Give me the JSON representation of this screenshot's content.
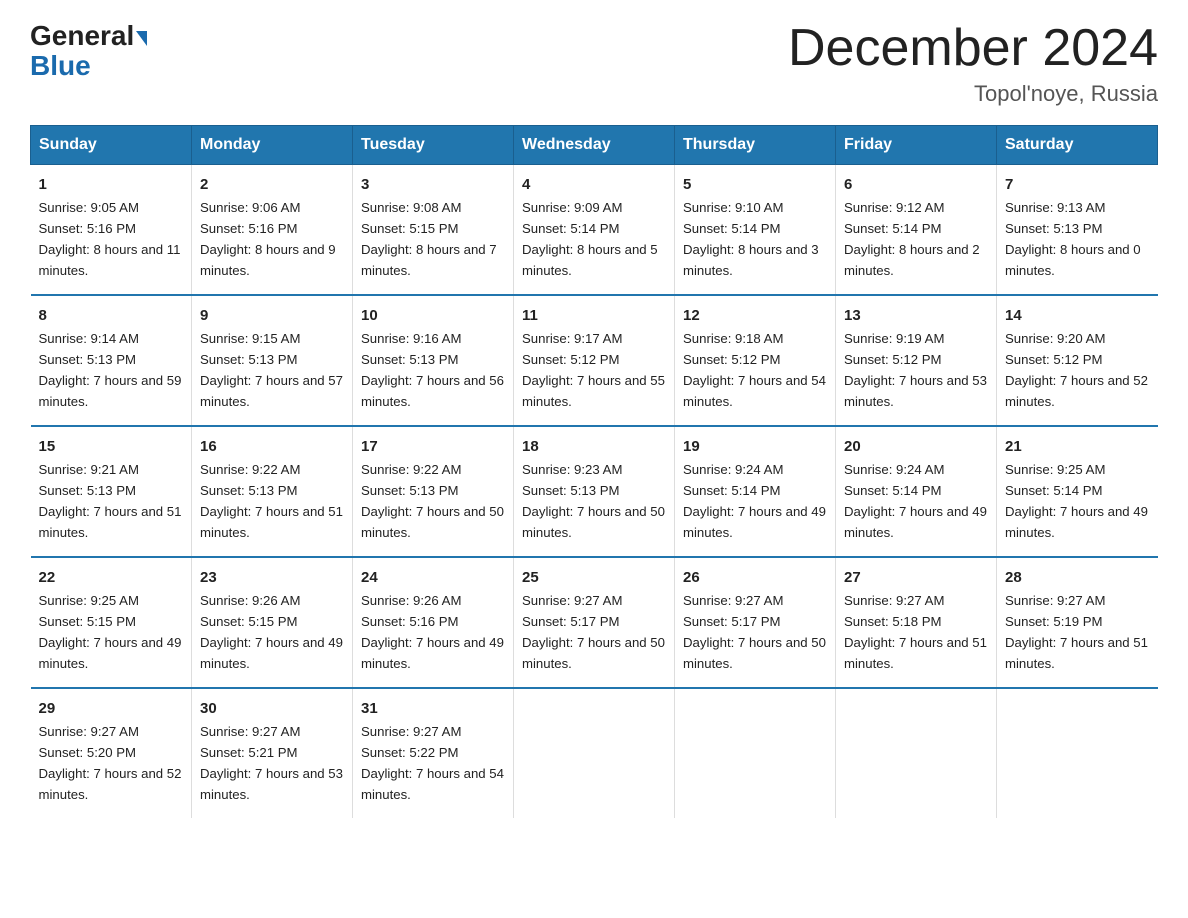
{
  "header": {
    "logo_general": "General",
    "logo_blue": "Blue",
    "month_title": "December 2024",
    "location": "Topol'noye, Russia"
  },
  "days_of_week": [
    "Sunday",
    "Monday",
    "Tuesday",
    "Wednesday",
    "Thursday",
    "Friday",
    "Saturday"
  ],
  "weeks": [
    [
      {
        "day": "1",
        "sunrise": "9:05 AM",
        "sunset": "5:16 PM",
        "daylight": "8 hours and 11 minutes."
      },
      {
        "day": "2",
        "sunrise": "9:06 AM",
        "sunset": "5:16 PM",
        "daylight": "8 hours and 9 minutes."
      },
      {
        "day": "3",
        "sunrise": "9:08 AM",
        "sunset": "5:15 PM",
        "daylight": "8 hours and 7 minutes."
      },
      {
        "day": "4",
        "sunrise": "9:09 AM",
        "sunset": "5:14 PM",
        "daylight": "8 hours and 5 minutes."
      },
      {
        "day": "5",
        "sunrise": "9:10 AM",
        "sunset": "5:14 PM",
        "daylight": "8 hours and 3 minutes."
      },
      {
        "day": "6",
        "sunrise": "9:12 AM",
        "sunset": "5:14 PM",
        "daylight": "8 hours and 2 minutes."
      },
      {
        "day": "7",
        "sunrise": "9:13 AM",
        "sunset": "5:13 PM",
        "daylight": "8 hours and 0 minutes."
      }
    ],
    [
      {
        "day": "8",
        "sunrise": "9:14 AM",
        "sunset": "5:13 PM",
        "daylight": "7 hours and 59 minutes."
      },
      {
        "day": "9",
        "sunrise": "9:15 AM",
        "sunset": "5:13 PM",
        "daylight": "7 hours and 57 minutes."
      },
      {
        "day": "10",
        "sunrise": "9:16 AM",
        "sunset": "5:13 PM",
        "daylight": "7 hours and 56 minutes."
      },
      {
        "day": "11",
        "sunrise": "9:17 AM",
        "sunset": "5:12 PM",
        "daylight": "7 hours and 55 minutes."
      },
      {
        "day": "12",
        "sunrise": "9:18 AM",
        "sunset": "5:12 PM",
        "daylight": "7 hours and 54 minutes."
      },
      {
        "day": "13",
        "sunrise": "9:19 AM",
        "sunset": "5:12 PM",
        "daylight": "7 hours and 53 minutes."
      },
      {
        "day": "14",
        "sunrise": "9:20 AM",
        "sunset": "5:12 PM",
        "daylight": "7 hours and 52 minutes."
      }
    ],
    [
      {
        "day": "15",
        "sunrise": "9:21 AM",
        "sunset": "5:13 PM",
        "daylight": "7 hours and 51 minutes."
      },
      {
        "day": "16",
        "sunrise": "9:22 AM",
        "sunset": "5:13 PM",
        "daylight": "7 hours and 51 minutes."
      },
      {
        "day": "17",
        "sunrise": "9:22 AM",
        "sunset": "5:13 PM",
        "daylight": "7 hours and 50 minutes."
      },
      {
        "day": "18",
        "sunrise": "9:23 AM",
        "sunset": "5:13 PM",
        "daylight": "7 hours and 50 minutes."
      },
      {
        "day": "19",
        "sunrise": "9:24 AM",
        "sunset": "5:14 PM",
        "daylight": "7 hours and 49 minutes."
      },
      {
        "day": "20",
        "sunrise": "9:24 AM",
        "sunset": "5:14 PM",
        "daylight": "7 hours and 49 minutes."
      },
      {
        "day": "21",
        "sunrise": "9:25 AM",
        "sunset": "5:14 PM",
        "daylight": "7 hours and 49 minutes."
      }
    ],
    [
      {
        "day": "22",
        "sunrise": "9:25 AM",
        "sunset": "5:15 PM",
        "daylight": "7 hours and 49 minutes."
      },
      {
        "day": "23",
        "sunrise": "9:26 AM",
        "sunset": "5:15 PM",
        "daylight": "7 hours and 49 minutes."
      },
      {
        "day": "24",
        "sunrise": "9:26 AM",
        "sunset": "5:16 PM",
        "daylight": "7 hours and 49 minutes."
      },
      {
        "day": "25",
        "sunrise": "9:27 AM",
        "sunset": "5:17 PM",
        "daylight": "7 hours and 50 minutes."
      },
      {
        "day": "26",
        "sunrise": "9:27 AM",
        "sunset": "5:17 PM",
        "daylight": "7 hours and 50 minutes."
      },
      {
        "day": "27",
        "sunrise": "9:27 AM",
        "sunset": "5:18 PM",
        "daylight": "7 hours and 51 minutes."
      },
      {
        "day": "28",
        "sunrise": "9:27 AM",
        "sunset": "5:19 PM",
        "daylight": "7 hours and 51 minutes."
      }
    ],
    [
      {
        "day": "29",
        "sunrise": "9:27 AM",
        "sunset": "5:20 PM",
        "daylight": "7 hours and 52 minutes."
      },
      {
        "day": "30",
        "sunrise": "9:27 AM",
        "sunset": "5:21 PM",
        "daylight": "7 hours and 53 minutes."
      },
      {
        "day": "31",
        "sunrise": "9:27 AM",
        "sunset": "5:22 PM",
        "daylight": "7 hours and 54 minutes."
      },
      null,
      null,
      null,
      null
    ]
  ],
  "labels": {
    "sunrise": "Sunrise:",
    "sunset": "Sunset:",
    "daylight": "Daylight:"
  }
}
